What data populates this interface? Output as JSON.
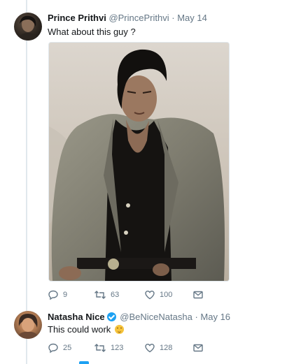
{
  "tweets": [
    {
      "name": "Prince Prithvi",
      "handle": "@PrincePrithvi",
      "separator": "·",
      "date": "May 14",
      "text": "What about this guy ?",
      "replies": "9",
      "retweets": "63",
      "likes": "100"
    },
    {
      "name": "Natasha Nice",
      "handle": "@BeNiceNatasha",
      "separator": "·",
      "date": "May 16",
      "text": "This could work",
      "replies": "25",
      "retweets": "123",
      "likes": "128"
    }
  ],
  "icons": {
    "reply": "reply-icon",
    "retweet": "retweet-icon",
    "like": "heart-icon",
    "dm": "direct-message-icon",
    "emoji": "grimacing-face-emoji",
    "verified": "verified-badge-icon"
  },
  "colors": {
    "icon_gray": "#657786",
    "verified_blue": "#1da1f2",
    "thread_line": "#e1e8ed"
  }
}
